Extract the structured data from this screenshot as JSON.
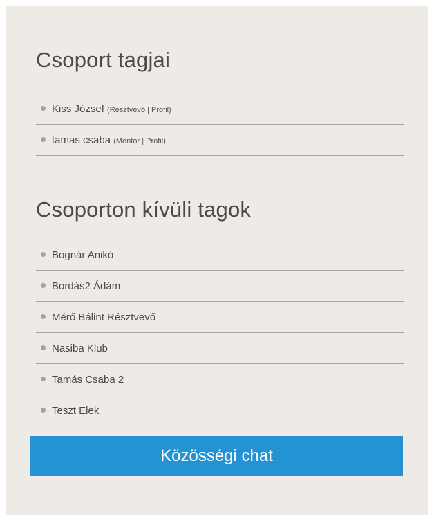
{
  "group_members": {
    "title": "Csoport tagjai",
    "items": [
      {
        "name": "Kiss József",
        "role": "Résztvevő",
        "profile_label": "Profil"
      },
      {
        "name": "tamas csaba",
        "role": "Mentor",
        "profile_label": "Profil"
      }
    ]
  },
  "outside_members": {
    "title": "Csoporton kívüli tagok",
    "items": [
      {
        "name": "Bognár Anikó"
      },
      {
        "name": "Bordás2 Ádám"
      },
      {
        "name": "Mérő Bálint Résztvevő"
      },
      {
        "name": "Nasiba Klub"
      },
      {
        "name": "Tamás Csaba 2"
      },
      {
        "name": "Teszt Elek"
      }
    ]
  },
  "chat_button": {
    "label": "Közösségi chat"
  },
  "colors": {
    "panel_background": "#eeebe6",
    "button_background": "#2393d4",
    "bullet": "#a3a3a3",
    "divider": "#a8a8a8"
  },
  "icons": {
    "bullet": "bullet-dot-icon"
  }
}
